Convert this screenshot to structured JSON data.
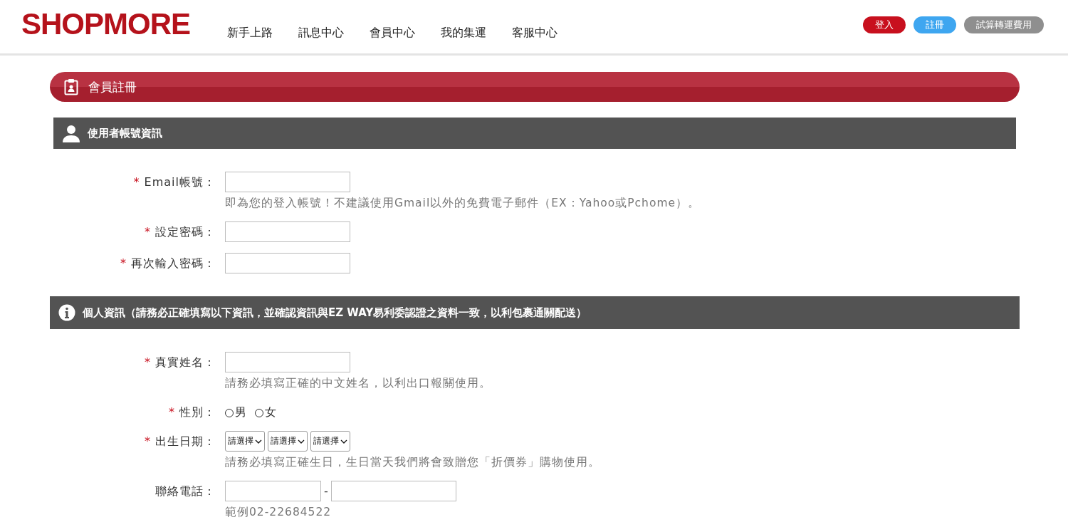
{
  "header": {
    "logo": "SHOPMORE",
    "nav": [
      "新手上路",
      "訊息中心",
      "會員中心",
      "我的集運",
      "客服中心"
    ],
    "actions": [
      {
        "label": "登入",
        "kind": "login"
      },
      {
        "label": "註冊",
        "kind": "register"
      },
      {
        "label": "試算轉運費用",
        "kind": "estimate"
      }
    ]
  },
  "page_title": "會員註冊",
  "sections": [
    {
      "title": "使用者帳號資訊",
      "kind": "account",
      "fields": [
        {
          "kind": "text",
          "label": "Email帳號：",
          "mark": "*",
          "hint": "即為您的登入帳號！不建議使用Gmail以外的免費電子郵件（EX：Yahoo或Pchome）。"
        },
        {
          "kind": "text",
          "label": "設定密碼：",
          "mark": "*"
        },
        {
          "kind": "text",
          "label": "再次輸入密碼：",
          "mark": "*"
        }
      ]
    },
    {
      "title": "個人資訊（請務必正確填寫以下資訊，並確認資訊與EZ WAY易利委認證之資料一致，以利包裹通關配送）",
      "kind": "personal",
      "fields": [
        {
          "kind": "text",
          "label": "真實姓名：",
          "mark": "*",
          "hint": "請務必填寫正確的中文姓名，以利出口報關使用。"
        },
        {
          "kind": "radio",
          "label": "性別：",
          "mark": "*",
          "options": [
            {
              "label": "男",
              "selected": false
            },
            {
              "label": "女",
              "selected": false
            }
          ]
        },
        {
          "kind": "selects",
          "label": "出生日期：",
          "mark": "*",
          "selects": [
            "請選擇",
            "請選擇",
            "請選擇"
          ],
          "hint": "請務必填寫正確生日，生日當天我們將會致贈您「折價券」購物使用。"
        },
        {
          "kind": "phone",
          "label": "聯絡電話：",
          "separator": "-",
          "hint": "範例02-22684522"
        }
      ]
    }
  ]
}
